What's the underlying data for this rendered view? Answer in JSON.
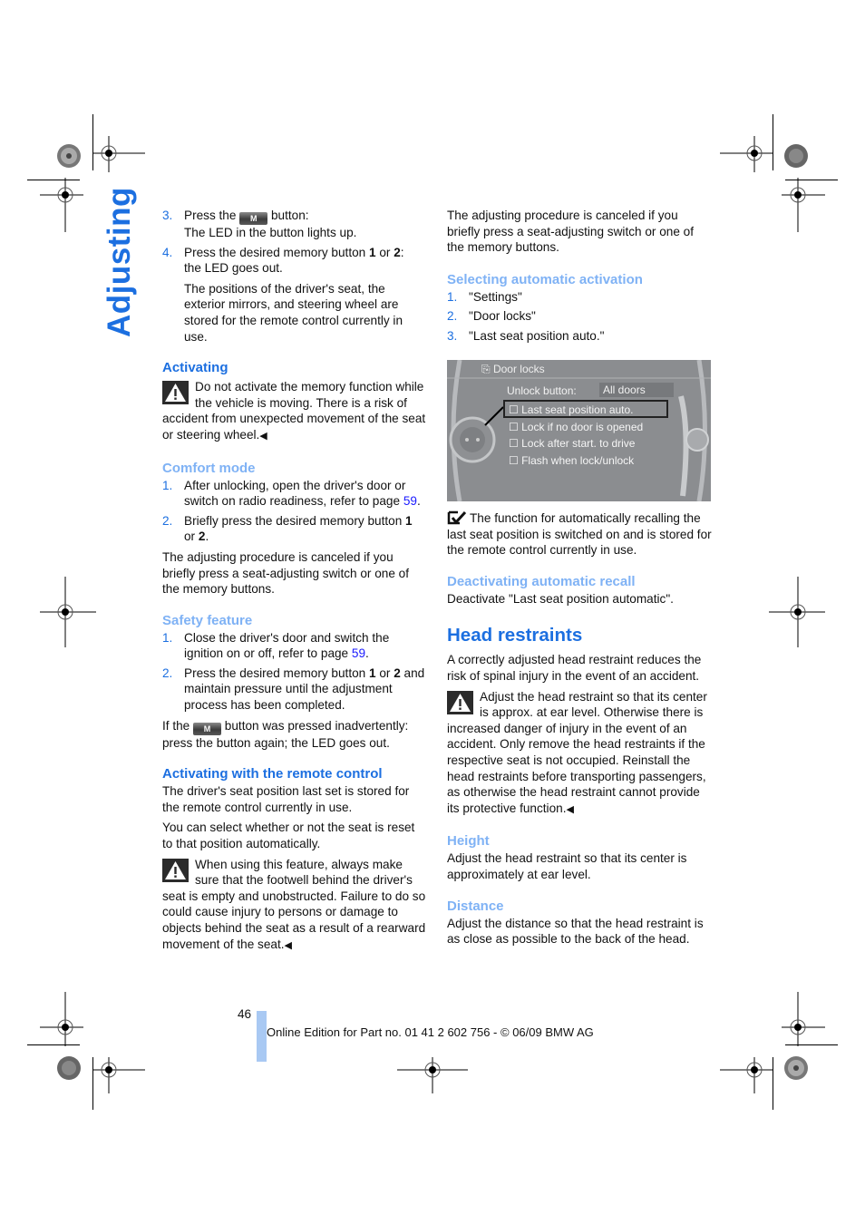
{
  "side_title": "Adjusting",
  "left_column": {
    "steps_top": [
      {
        "num": "3.",
        "pre": "Press the",
        "btn": "M",
        "post": "button:",
        "line2": "The LED in the button lights up."
      },
      {
        "num": "4.",
        "pre": "Press the desired memory button ",
        "b1": "1",
        "mid": " or ",
        "b2": "2",
        "post": ":",
        "line2": "the LED goes out."
      }
    ],
    "steps_note": "The positions of the driver's seat, the exterior mirrors, and steering wheel are stored for the remote control currently in use.",
    "activating": {
      "heading": "Activating",
      "warning": "Do not activate the memory function while the vehicle is moving. There is a risk of accident from unexpected movement of the seat or steering wheel.",
      "end_mark": "◀"
    },
    "comfort_mode": {
      "heading": "Comfort mode",
      "items": [
        {
          "num": "1.",
          "text": "After unlocking, open the driver's door or switch on radio readiness, refer to page ",
          "link": "59",
          "after": "."
        },
        {
          "num": "2.",
          "text": "Briefly press the desired memory button ",
          "b1": "1",
          "mid": " or ",
          "b2": "2",
          "after": "."
        }
      ],
      "note": "The adjusting procedure is canceled if you briefly press a seat-adjusting switch or one of the memory buttons."
    },
    "safety_feature": {
      "heading": "Safety feature",
      "items": [
        {
          "num": "1.",
          "text": "Close the driver's door and switch the ignition on or off, refer to page ",
          "link": "59",
          "after": "."
        },
        {
          "num": "2.",
          "text": "Press the desired memory button ",
          "b1": "1",
          "mid": " or ",
          "b2": "2",
          "after": " and maintain pressure until the adjustment process has been completed."
        }
      ],
      "note_pre": "If the",
      "note_btn": "M",
      "note_post": "button was pressed inadvertently: press the button again; the LED goes out."
    },
    "remote": {
      "heading": "Activating with the remote control",
      "p1": "The driver's seat position last set is stored for the remote control currently in use.",
      "p2": "You can select whether or not the seat is reset to that position automatically.",
      "warning": "When using this feature, always make sure that the footwell behind the driver's seat is empty and unobstructed. Failure to do so could cause injury to persons or damage to objects behind the seat as a result of a rearward movement of the seat.",
      "end_mark": "◀"
    }
  },
  "right_column": {
    "intro": "The adjusting procedure is canceled if you briefly press a seat-adjusting switch or one of the memory buttons.",
    "selecting": {
      "heading": "Selecting automatic activation",
      "items": [
        {
          "num": "1.",
          "text": "\"Settings\""
        },
        {
          "num": "2.",
          "text": "\"Door locks\""
        },
        {
          "num": "3.",
          "text": "\"Last seat position auto.\""
        }
      ]
    },
    "screen": {
      "title": "Door locks",
      "unlock_label": "Unlock button:",
      "unlock_value": "All doors",
      "options": [
        {
          "label": "Last seat position auto.",
          "selected": true
        },
        {
          "label": "Lock if no door is opened",
          "selected": false
        },
        {
          "label": "Lock after start. to drive",
          "selected": false
        },
        {
          "label": "Flash when lock/unlock",
          "selected": false
        }
      ]
    },
    "check_note": "The function for automatically recalling the last seat position is switched on and is stored for the remote control currently in use.",
    "deactivating": {
      "heading": "Deactivating automatic recall",
      "text": "Deactivate \"Last seat position automatic\"."
    },
    "head_restraints": {
      "heading": "Head restraints",
      "intro": "A correctly adjusted head restraint reduces the risk of spinal injury in the event of an accident.",
      "warning": "Adjust the head restraint so that its center is approx. at ear level. Otherwise there is increased danger of injury in the event of an accident. Only remove the head restraints if the respective seat is not occupied. Reinstall the head restraints before transporting passengers, as otherwise the head restraint cannot provide its protective function.",
      "end_mark": "◀"
    },
    "height": {
      "heading": "Height",
      "text": "Adjust the head restraint so that its center is approximately at ear level."
    },
    "distance": {
      "heading": "Distance",
      "text": "Adjust the distance so that the head restraint is as close as possible to the back of the head."
    }
  },
  "footer": {
    "page_number": "46",
    "text": "Online Edition for Part no. 01 41 2 602 756 - © 06/09 BMW AG"
  },
  "colors": {
    "heading_blue": "#1c6fe0",
    "subheading_light_blue": "#7fb2f5",
    "footer_bar": "#a9c9f3",
    "link": "#1a1aff"
  }
}
